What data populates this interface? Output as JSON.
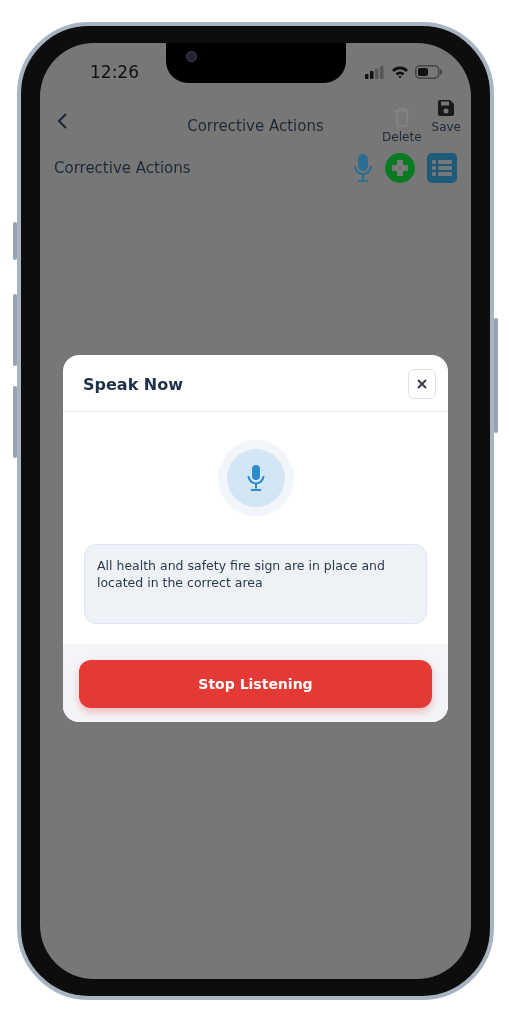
{
  "status_bar": {
    "time": "12:26"
  },
  "nav_bar": {
    "title": "Corrective Actions",
    "actions": [
      {
        "kind": "delete",
        "label": "Delete",
        "disabled": true
      },
      {
        "kind": "save",
        "label": "Save",
        "disabled": false
      }
    ]
  },
  "section": {
    "title": "Corrective Actions",
    "tools": [
      {
        "kind": "mic"
      },
      {
        "kind": "add"
      },
      {
        "kind": "list"
      }
    ]
  },
  "dialog": {
    "title": "Speak Now",
    "transcript": "All health and safety fire sign are in place and located in the correct area",
    "button": "Stop Listening"
  }
}
